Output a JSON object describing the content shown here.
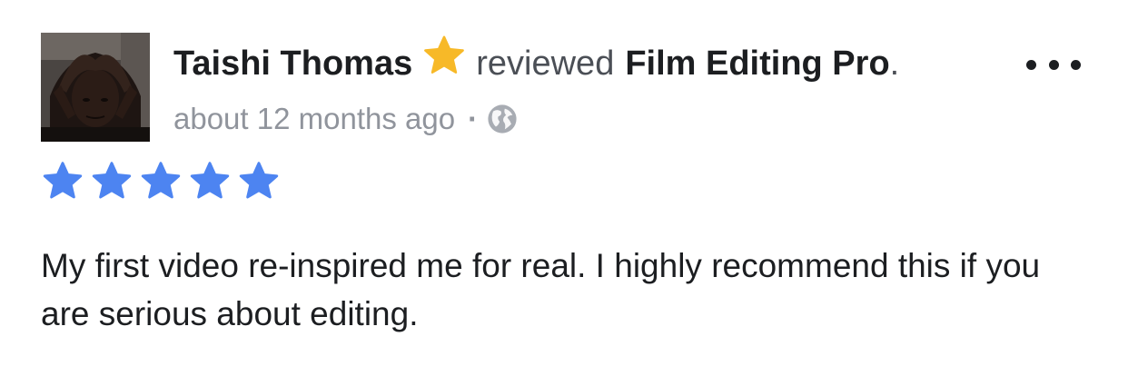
{
  "review": {
    "author": "Taishi Thomas",
    "action": "reviewed",
    "page": "Film Editing Pro",
    "period": ".",
    "timestamp": "about 12 months ago",
    "separator": "·",
    "privacy_icon": "globe-icon",
    "author_badge_icon": "star-icon",
    "more_icon": "ellipsis-icon",
    "rating": {
      "stars": 5,
      "max": 5,
      "icon": "star-icon"
    },
    "text": "My first video re-inspired me for real. I highly recommend this if you are serious about editing."
  },
  "colors": {
    "badge_star": "#f7b928",
    "rating_star": "#4d84f1",
    "text_primary": "#1c1e21",
    "text_secondary": "#4b4f56",
    "meta": "#90949c",
    "globe": "#a8acb3"
  }
}
